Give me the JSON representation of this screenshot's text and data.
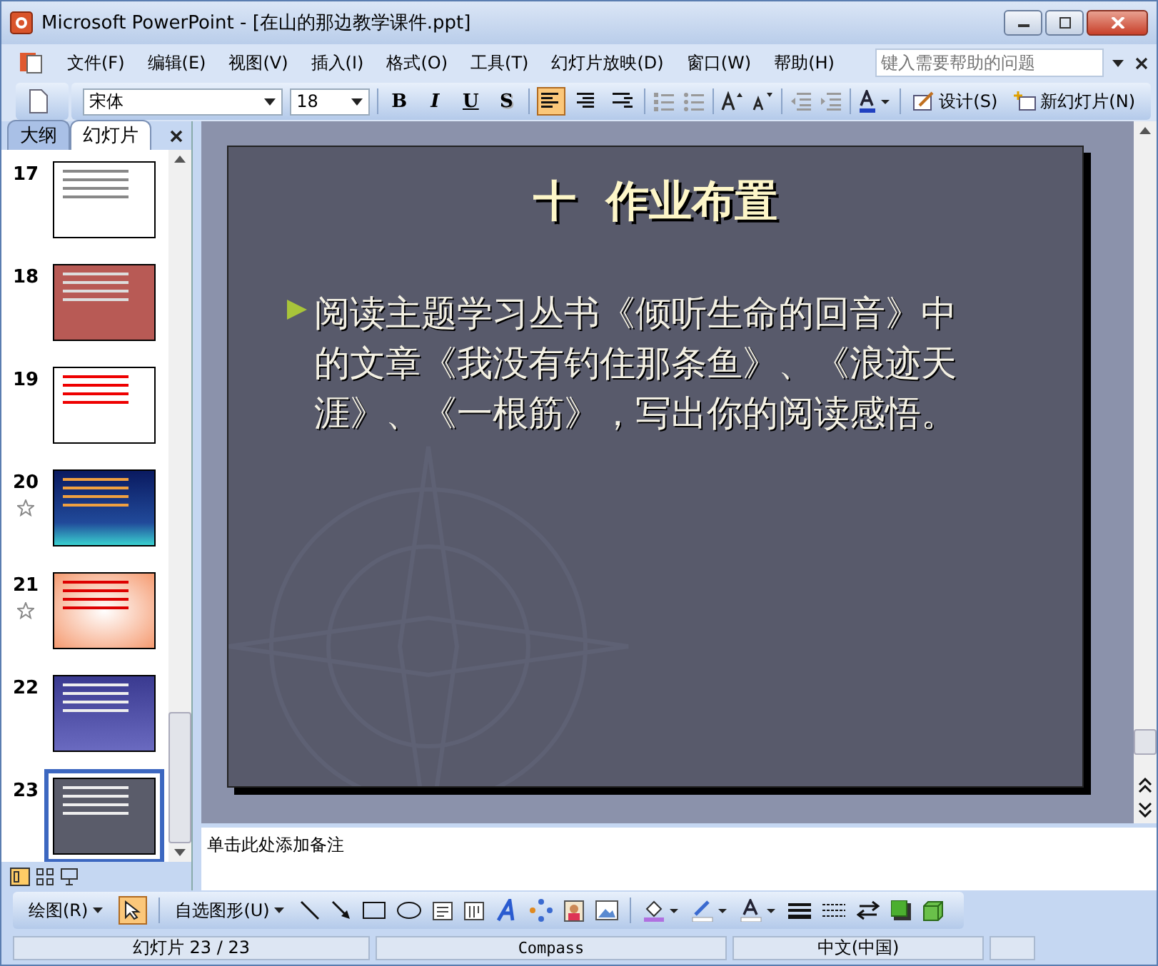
{
  "window": {
    "title": "Microsoft PowerPoint - [在山的那边教学课件.ppt]"
  },
  "menu": [
    "文件(F)",
    "编辑(E)",
    "视图(V)",
    "插入(I)",
    "格式(O)",
    "工具(T)",
    "幻灯片放映(D)",
    "窗口(W)",
    "帮助(H)"
  ],
  "help_box": {
    "placeholder": "键入需要帮助的问题"
  },
  "formatting": {
    "font": "宋体",
    "size": "18",
    "styles": [
      {
        "label": "B",
        "kind": "bold"
      },
      {
        "label": "I",
        "kind": "italic"
      },
      {
        "label": "U",
        "kind": "underline"
      },
      {
        "label": "S",
        "kind": "shadow"
      }
    ],
    "alignment": [
      {
        "kind": "left",
        "selected": true
      },
      {
        "kind": "center",
        "selected": false
      },
      {
        "kind": "right",
        "selected": false
      }
    ],
    "design_button": "设计(S)",
    "new_slide_button": "新幻灯片(N)"
  },
  "pane_tabs": [
    {
      "label": "大纲",
      "selected": false
    },
    {
      "label": "幻灯片",
      "selected": true
    }
  ],
  "thumbnails": [
    {
      "number": "17",
      "kind": "white",
      "animated": false,
      "selected": false
    },
    {
      "number": "18",
      "kind": "red",
      "animated": false,
      "selected": false
    },
    {
      "number": "19",
      "kind": "plain",
      "animated": false,
      "selected": false
    },
    {
      "number": "20",
      "kind": "night",
      "animated": true,
      "selected": false
    },
    {
      "number": "21",
      "kind": "peach",
      "animated": true,
      "selected": false
    },
    {
      "number": "22",
      "kind": "sea",
      "animated": false,
      "selected": false
    },
    {
      "number": "23",
      "kind": "slate",
      "animated": false,
      "selected": true
    }
  ],
  "slide": {
    "title": "十  作业布置",
    "bullets": [
      "阅读主题学习丛书《倾听生命的回音》中的文章《我没有钓住那条鱼》、《浪迹天涯》、《一根筋》，写出你的阅读感悟。"
    ]
  },
  "notes_prompt": "单击此处添加备注",
  "drawing_toolbar": {
    "draw_menu": "绘图(R)",
    "autoshapes_menu": "自选图形(U)"
  },
  "status_bar": [
    "幻灯片 23 / 23",
    "Compass",
    "中文(中国)"
  ]
}
